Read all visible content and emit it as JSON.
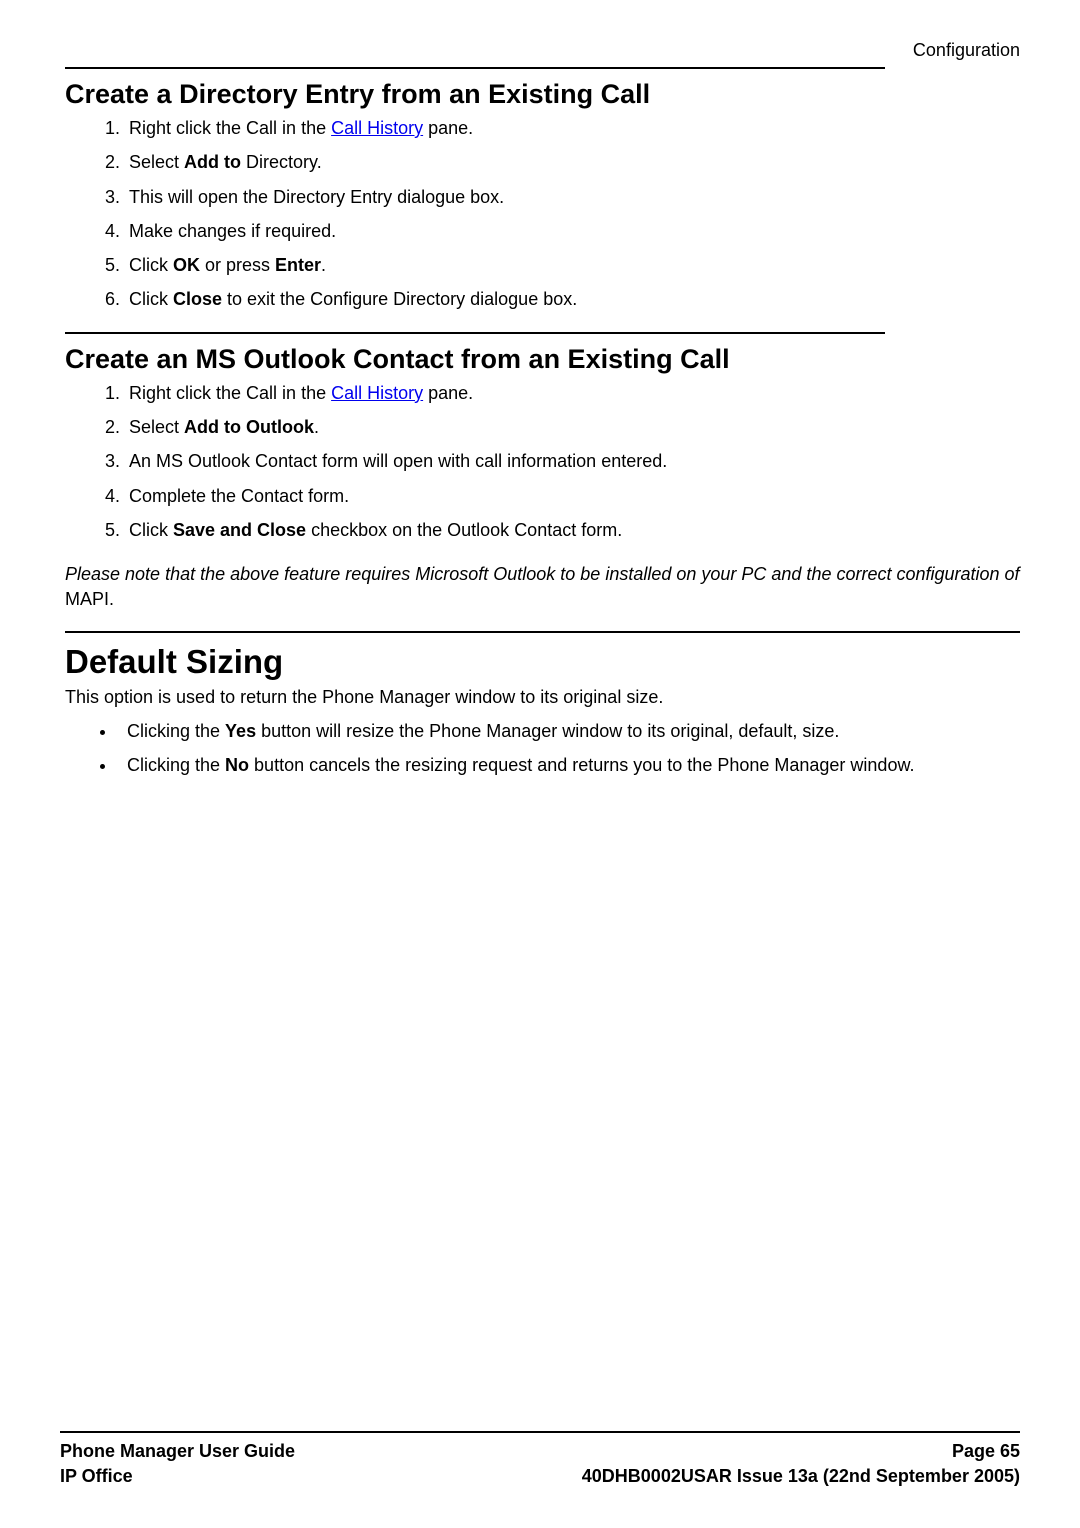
{
  "header": {
    "breadcrumb": "Configuration"
  },
  "section1": {
    "heading": "Create a Directory Entry from an Existing Call",
    "steps": {
      "s1_pre": "Right click the Call in the ",
      "s1_link": "Call History",
      "s1_post": " pane.",
      "s2_pre": "Select ",
      "s2_b": "Add to",
      "s2_post": " Directory.",
      "s3": "This will open the Directory Entry dialogue box.",
      "s4": "Make changes if required.",
      "s5_pre": "Click ",
      "s5_b1": "OK",
      "s5_mid": " or press ",
      "s5_b2": "Enter",
      "s5_post": ".",
      "s6_pre": "Click ",
      "s6_b": "Close",
      "s6_post": " to exit the Configure Directory dialogue box."
    }
  },
  "section2": {
    "heading": "Create an MS Outlook Contact from an Existing Call",
    "steps": {
      "s1_pre": "Right click the Call in the ",
      "s1_link": "Call History",
      "s1_post": " pane.",
      "s2_pre": "Select ",
      "s2_b": "Add to Outlook",
      "s2_post": ".",
      "s3": "An MS Outlook Contact form will open with call information entered.",
      "s4": "Complete the Contact form.",
      "s5_pre": "Click ",
      "s5_b": "Save and Close",
      "s5_post": " checkbox on the Outlook Contact form."
    },
    "note_pre": "Please note that the above feature requires Microsoft Outlook to be installed on your PC and the correct configuration of ",
    "note_post": "MAPI."
  },
  "section3": {
    "heading": "Default Sizing",
    "intro": "This option is used to return the Phone Manager window to its original size.",
    "b1_pre": "Clicking the ",
    "b1_b": "Yes",
    "b1_post": " button will resize the Phone Manager window to its original, default, size.",
    "b2_pre": "Clicking the ",
    "b2_b": "No",
    "b2_post": " button cancels the resizing request and returns you to the Phone Manager window."
  },
  "footer": {
    "left1": "Phone Manager User Guide",
    "left2": "IP Office",
    "right1": "Page 65",
    "right2": "40DHB0002USAR Issue 13a (22nd September 2005)"
  }
}
